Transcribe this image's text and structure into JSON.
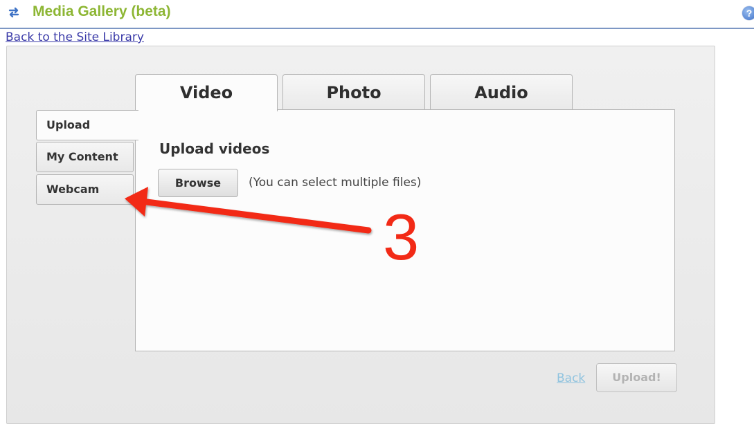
{
  "header": {
    "title": "Media Gallery (beta)",
    "help_label": "?",
    "back_link": "Back to the Site Library"
  },
  "tabs": [
    {
      "label": "Video",
      "active": true
    },
    {
      "label": "Photo",
      "active": false
    },
    {
      "label": "Audio",
      "active": false
    }
  ],
  "sidebar": {
    "items": [
      {
        "label": "Upload",
        "active": true
      },
      {
        "label": "My Content",
        "active": false
      },
      {
        "label": "Webcam",
        "active": false
      }
    ]
  },
  "main": {
    "heading": "Upload videos",
    "browse_label": "Browse",
    "hint": "(You can select multiple files)"
  },
  "footer": {
    "back_label": "Back",
    "upload_label": "Upload!"
  },
  "annotation": {
    "step": "3",
    "color": "#f22a16"
  },
  "colors": {
    "title_green": "#8db634",
    "link_blue": "#3a3aa8"
  }
}
